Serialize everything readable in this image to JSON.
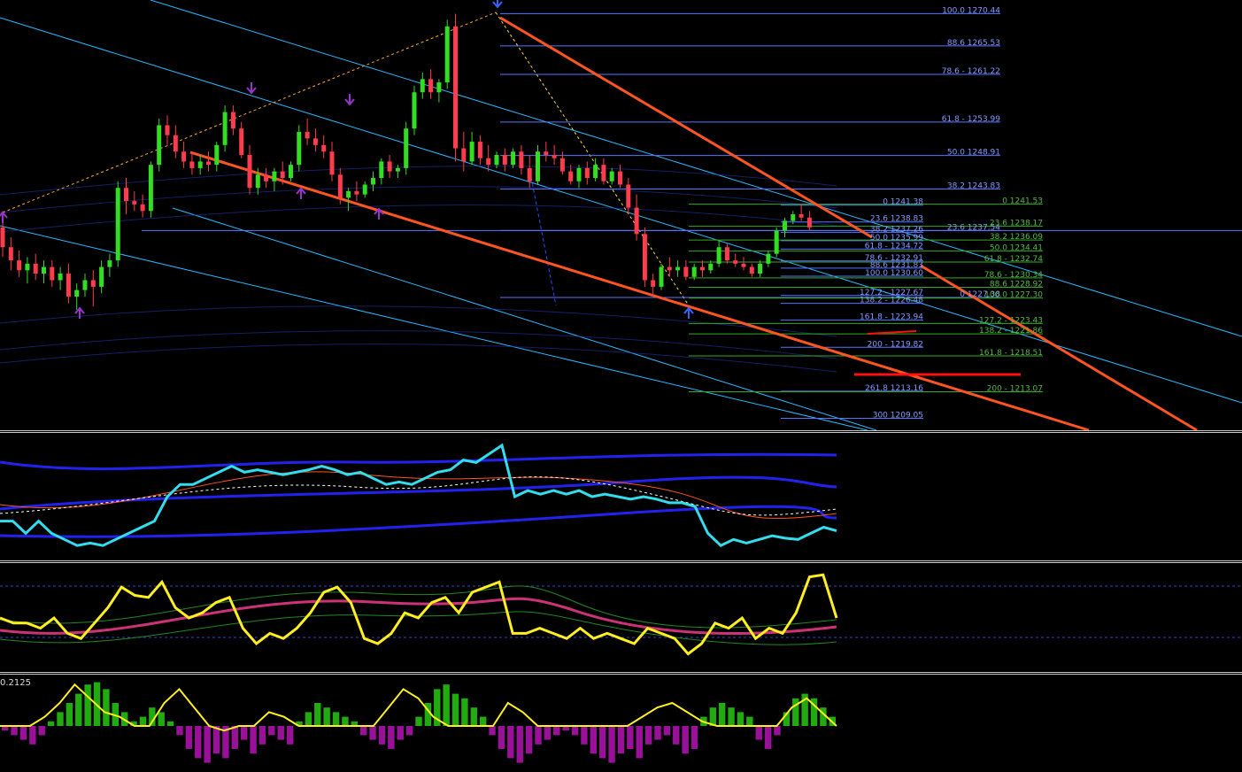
{
  "chart_data": [
    {
      "type": "candlestick",
      "panel": "price",
      "colors": {
        "up": "#33dd22",
        "down": "#ff3b4e",
        "fib_primary": "#5577ff",
        "fib_secondary": "#33aa22",
        "trendline": "#ff5522",
        "channel": "#2ab8ff",
        "arrow": "#9933cc",
        "arrow_blue": "#3366ff"
      },
      "ylim": [
        1207.5,
        1272.5
      ],
      "candles": [
        {
          "o": 1238.0,
          "h": 1240.5,
          "l": 1233.5,
          "c": 1235.0
        },
        {
          "o": 1235.0,
          "h": 1236.5,
          "l": 1231.5,
          "c": 1233.0
        },
        {
          "o": 1233.0,
          "h": 1234.5,
          "l": 1230.5,
          "c": 1231.5
        },
        {
          "o": 1231.5,
          "h": 1233.5,
          "l": 1229.5,
          "c": 1232.5
        },
        {
          "o": 1232.5,
          "h": 1234.0,
          "l": 1230.0,
          "c": 1231.0
        },
        {
          "o": 1231.0,
          "h": 1233.0,
          "l": 1229.5,
          "c": 1232.0
        },
        {
          "o": 1232.0,
          "h": 1233.0,
          "l": 1229.0,
          "c": 1230.0
        },
        {
          "o": 1230.0,
          "h": 1232.0,
          "l": 1228.5,
          "c": 1231.0
        },
        {
          "o": 1231.0,
          "h": 1232.5,
          "l": 1226.5,
          "c": 1227.5
        },
        {
          "o": 1227.5,
          "h": 1229.5,
          "l": 1225.5,
          "c": 1228.5
        },
        {
          "o": 1228.5,
          "h": 1231.0,
          "l": 1227.5,
          "c": 1230.0
        },
        {
          "o": 1230.0,
          "h": 1231.5,
          "l": 1226.0,
          "c": 1229.0
        },
        {
          "o": 1229.0,
          "h": 1233.0,
          "l": 1228.0,
          "c": 1232.0
        },
        {
          "o": 1232.0,
          "h": 1234.0,
          "l": 1230.5,
          "c": 1233.0
        },
        {
          "o": 1233.0,
          "h": 1245.0,
          "l": 1232.0,
          "c": 1244.0
        },
        {
          "o": 1244.0,
          "h": 1245.5,
          "l": 1240.0,
          "c": 1242.0
        },
        {
          "o": 1242.0,
          "h": 1243.5,
          "l": 1240.5,
          "c": 1241.5
        },
        {
          "o": 1241.5,
          "h": 1243.0,
          "l": 1239.5,
          "c": 1240.5
        },
        {
          "o": 1240.5,
          "h": 1248.0,
          "l": 1239.5,
          "c": 1247.5
        },
        {
          "o": 1247.5,
          "h": 1254.5,
          "l": 1246.5,
          "c": 1253.5
        },
        {
          "o": 1253.5,
          "h": 1255.0,
          "l": 1250.5,
          "c": 1252.0
        },
        {
          "o": 1252.0,
          "h": 1253.5,
          "l": 1248.5,
          "c": 1249.5
        },
        {
          "o": 1249.5,
          "h": 1251.0,
          "l": 1247.0,
          "c": 1248.0
        },
        {
          "o": 1248.0,
          "h": 1249.5,
          "l": 1246.0,
          "c": 1247.0
        },
        {
          "o": 1247.0,
          "h": 1249.0,
          "l": 1246.0,
          "c": 1248.0
        },
        {
          "o": 1248.0,
          "h": 1249.5,
          "l": 1246.5,
          "c": 1247.5
        },
        {
          "o": 1247.5,
          "h": 1251.0,
          "l": 1246.5,
          "c": 1250.5
        },
        {
          "o": 1250.5,
          "h": 1256.5,
          "l": 1249.5,
          "c": 1255.5
        },
        {
          "o": 1255.5,
          "h": 1256.5,
          "l": 1252.0,
          "c": 1253.0
        },
        {
          "o": 1253.0,
          "h": 1254.0,
          "l": 1248.5,
          "c": 1249.0
        },
        {
          "o": 1249.0,
          "h": 1250.5,
          "l": 1243.0,
          "c": 1244.0
        },
        {
          "o": 1244.0,
          "h": 1247.0,
          "l": 1243.0,
          "c": 1246.0
        },
        {
          "o": 1246.0,
          "h": 1247.0,
          "l": 1244.0,
          "c": 1245.0
        },
        {
          "o": 1245.0,
          "h": 1247.0,
          "l": 1243.5,
          "c": 1246.5
        },
        {
          "o": 1246.5,
          "h": 1248.0,
          "l": 1244.5,
          "c": 1245.5
        },
        {
          "o": 1245.5,
          "h": 1248.0,
          "l": 1245.0,
          "c": 1247.5
        },
        {
          "o": 1247.5,
          "h": 1253.5,
          "l": 1246.5,
          "c": 1252.5
        },
        {
          "o": 1252.5,
          "h": 1254.5,
          "l": 1250.5,
          "c": 1251.5
        },
        {
          "o": 1251.5,
          "h": 1253.0,
          "l": 1249.5,
          "c": 1250.5
        },
        {
          "o": 1250.5,
          "h": 1252.0,
          "l": 1248.5,
          "c": 1249.5
        },
        {
          "o": 1249.5,
          "h": 1251.0,
          "l": 1245.0,
          "c": 1246.0
        },
        {
          "o": 1246.0,
          "h": 1247.0,
          "l": 1241.5,
          "c": 1242.5
        },
        {
          "o": 1242.5,
          "h": 1244.0,
          "l": 1240.5,
          "c": 1243.5
        },
        {
          "o": 1243.5,
          "h": 1245.0,
          "l": 1242.0,
          "c": 1243.0
        },
        {
          "o": 1243.0,
          "h": 1245.0,
          "l": 1242.5,
          "c": 1244.5
        },
        {
          "o": 1244.5,
          "h": 1246.5,
          "l": 1243.5,
          "c": 1245.5
        },
        {
          "o": 1245.5,
          "h": 1248.5,
          "l": 1244.5,
          "c": 1248.0
        },
        {
          "o": 1248.0,
          "h": 1249.0,
          "l": 1245.5,
          "c": 1246.5
        },
        {
          "o": 1246.5,
          "h": 1247.5,
          "l": 1245.5,
          "c": 1247.0
        },
        {
          "o": 1247.0,
          "h": 1254.0,
          "l": 1246.0,
          "c": 1253.0
        },
        {
          "o": 1253.0,
          "h": 1259.5,
          "l": 1252.0,
          "c": 1258.5
        },
        {
          "o": 1258.5,
          "h": 1261.5,
          "l": 1257.5,
          "c": 1260.5
        },
        {
          "o": 1260.5,
          "h": 1262.0,
          "l": 1257.5,
          "c": 1258.5
        },
        {
          "o": 1258.5,
          "h": 1260.5,
          "l": 1257.0,
          "c": 1260.0
        },
        {
          "o": 1260.0,
          "h": 1269.5,
          "l": 1259.0,
          "c": 1268.5
        },
        {
          "o": 1268.5,
          "h": 1270.4,
          "l": 1248.0,
          "c": 1250.0
        },
        {
          "o": 1250.0,
          "h": 1252.5,
          "l": 1246.5,
          "c": 1248.0
        },
        {
          "o": 1248.0,
          "h": 1252.5,
          "l": 1247.5,
          "c": 1251.0
        },
        {
          "o": 1251.0,
          "h": 1252.0,
          "l": 1247.5,
          "c": 1248.5
        },
        {
          "o": 1248.5,
          "h": 1250.5,
          "l": 1246.5,
          "c": 1247.5
        },
        {
          "o": 1247.5,
          "h": 1249.5,
          "l": 1247.0,
          "c": 1249.0
        },
        {
          "o": 1249.0,
          "h": 1250.0,
          "l": 1246.5,
          "c": 1247.5
        },
        {
          "o": 1247.5,
          "h": 1250.0,
          "l": 1247.0,
          "c": 1249.5
        },
        {
          "o": 1249.5,
          "h": 1250.5,
          "l": 1246.0,
          "c": 1247.0
        },
        {
          "o": 1247.0,
          "h": 1249.0,
          "l": 1244.0,
          "c": 1245.0
        },
        {
          "o": 1245.0,
          "h": 1250.5,
          "l": 1244.5,
          "c": 1249.5
        },
        {
          "o": 1249.5,
          "h": 1251.0,
          "l": 1248.0,
          "c": 1249.0
        },
        {
          "o": 1249.0,
          "h": 1250.5,
          "l": 1247.5,
          "c": 1248.5
        },
        {
          "o": 1248.5,
          "h": 1249.5,
          "l": 1246.0,
          "c": 1246.5
        },
        {
          "o": 1246.5,
          "h": 1247.5,
          "l": 1244.5,
          "c": 1245.0
        },
        {
          "o": 1245.0,
          "h": 1247.5,
          "l": 1244.0,
          "c": 1247.0
        },
        {
          "o": 1247.0,
          "h": 1248.0,
          "l": 1244.5,
          "c": 1245.5
        },
        {
          "o": 1245.5,
          "h": 1248.5,
          "l": 1245.0,
          "c": 1247.5
        },
        {
          "o": 1247.5,
          "h": 1248.5,
          "l": 1244.5,
          "c": 1245.0
        },
        {
          "o": 1245.0,
          "h": 1247.0,
          "l": 1244.5,
          "c": 1246.5
        },
        {
          "o": 1246.5,
          "h": 1247.5,
          "l": 1244.0,
          "c": 1244.5
        },
        {
          "o": 1244.5,
          "h": 1245.5,
          "l": 1240.0,
          "c": 1241.0
        },
        {
          "o": 1241.0,
          "h": 1243.0,
          "l": 1236.0,
          "c": 1237.0
        },
        {
          "o": 1237.0,
          "h": 1238.0,
          "l": 1229.0,
          "c": 1230.0
        },
        {
          "o": 1230.0,
          "h": 1231.0,
          "l": 1227.5,
          "c": 1229.0
        },
        {
          "o": 1229.0,
          "h": 1232.5,
          "l": 1228.5,
          "c": 1232.0
        },
        {
          "o": 1232.0,
          "h": 1233.5,
          "l": 1230.5,
          "c": 1231.5
        },
        {
          "o": 1231.5,
          "h": 1233.0,
          "l": 1230.5,
          "c": 1232.0
        },
        {
          "o": 1232.0,
          "h": 1233.0,
          "l": 1230.0,
          "c": 1230.5
        },
        {
          "o": 1230.5,
          "h": 1232.5,
          "l": 1230.0,
          "c": 1232.0
        },
        {
          "o": 1232.0,
          "h": 1233.0,
          "l": 1230.5,
          "c": 1231.5
        },
        {
          "o": 1231.5,
          "h": 1233.0,
          "l": 1231.0,
          "c": 1232.5
        },
        {
          "o": 1232.5,
          "h": 1236.0,
          "l": 1232.0,
          "c": 1235.0
        },
        {
          "o": 1235.0,
          "h": 1235.5,
          "l": 1232.5,
          "c": 1233.0
        },
        {
          "o": 1233.0,
          "h": 1234.0,
          "l": 1232.0,
          "c": 1232.5
        },
        {
          "o": 1232.5,
          "h": 1233.5,
          "l": 1231.5,
          "c": 1232.0
        },
        {
          "o": 1232.0,
          "h": 1232.5,
          "l": 1230.5,
          "c": 1231.0
        },
        {
          "o": 1231.0,
          "h": 1233.0,
          "l": 1230.5,
          "c": 1232.5
        },
        {
          "o": 1232.5,
          "h": 1234.5,
          "l": 1232.0,
          "c": 1234.0
        },
        {
          "o": 1234.0,
          "h": 1238.0,
          "l": 1233.5,
          "c": 1237.5
        },
        {
          "o": 1237.5,
          "h": 1239.5,
          "l": 1236.5,
          "c": 1239.0
        },
        {
          "o": 1239.0,
          "h": 1240.5,
          "l": 1238.5,
          "c": 1240.0
        },
        {
          "o": 1240.0,
          "h": 1241.5,
          "l": 1239.0,
          "c": 1239.5
        },
        {
          "o": 1239.5,
          "h": 1240.5,
          "l": 1237.5,
          "c": 1238.0
        }
      ],
      "fib_levels_primary": [
        {
          "label": "100.0 1270.44",
          "value": 1270.44
        },
        {
          "label": "88.6 1265.53",
          "value": 1265.53
        },
        {
          "label": "78.6 - 1261.22",
          "value": 1261.22
        },
        {
          "label": "61.8 - 1253.99",
          "value": 1253.99
        },
        {
          "label": "50.0 1248.91",
          "value": 1248.91
        },
        {
          "label": "38.2 1243.83",
          "value": 1243.83
        },
        {
          "label": "23.6 1237.54",
          "value": 1237.54
        },
        {
          "label": "0 1227.38",
          "value": 1227.38
        }
      ],
      "fib_levels_mid": [
        {
          "label": "0 1241.38",
          "value": 1241.38
        },
        {
          "label": "23.6 1238.83",
          "value": 1238.83
        },
        {
          "label": "38.2 1237.26",
          "value": 1237.26
        },
        {
          "label": "50.0 1235.99",
          "value": 1235.99
        },
        {
          "label": "61.8 - 1234.72",
          "value": 1234.72
        },
        {
          "label": "78.6 - 1232.91",
          "value": 1232.91
        },
        {
          "label": "88.6 1231.83",
          "value": 1231.83
        },
        {
          "label": "100.0 1230.60",
          "value": 1230.6
        },
        {
          "label": "127.2 - 1227.67",
          "value": 1227.67
        },
        {
          "label": "138.2 - 1226.48",
          "value": 1226.48
        },
        {
          "label": "161.8 - 1223.94",
          "value": 1223.94
        },
        {
          "label": "200 - 1219.82",
          "value": 1219.82
        },
        {
          "label": "261.8 1213.16",
          "value": 1213.16
        },
        {
          "label": "300 1209.05",
          "value": 1209.05
        }
      ],
      "fib_levels_secondary": [
        {
          "label": "0 1241.53",
          "value": 1241.53
        },
        {
          "label": "23.6 1238.17",
          "value": 1238.17
        },
        {
          "label": "38.2 1236.09",
          "value": 1236.09
        },
        {
          "label": "50.0 1234.41",
          "value": 1234.41
        },
        {
          "label": "61.8 - 1232.74",
          "value": 1232.74
        },
        {
          "label": "78.6 - 1230.34",
          "value": 1230.34
        },
        {
          "label": "88.6 1228.92",
          "value": 1228.92
        },
        {
          "label": "100.0 1227.30",
          "value": 1227.3
        },
        {
          "label": "127.2 - 1223.43",
          "value": 1223.43
        },
        {
          "label": "138.2 - 1221.86",
          "value": 1221.86
        },
        {
          "label": "161.8 - 1218.51",
          "value": 1218.51
        },
        {
          "label": "200 - 1213.07",
          "value": 1213.07
        }
      ]
    },
    {
      "type": "line",
      "panel": "indicator-1",
      "series": [
        {
          "values": [
            0.3,
            0.3,
            0.2,
            0.3,
            0.2,
            0.15,
            0.1,
            0.12,
            0.1,
            0.15,
            0.2,
            0.25,
            0.3,
            0.5,
            0.6,
            0.6,
            0.65,
            0.7,
            0.75,
            0.7,
            0.72,
            0.7,
            0.68,
            0.7,
            0.72,
            0.75,
            0.72,
            0.68,
            0.7,
            0.65,
            0.6,
            0.62,
            0.6,
            0.65,
            0.7,
            0.72,
            0.8,
            0.78,
            0.85,
            0.92,
            0.5,
            0.55,
            0.52,
            0.55,
            0.52,
            0.55,
            0.5,
            0.52,
            0.5,
            0.48,
            0.5,
            0.48,
            0.45,
            0.45,
            0.42,
            0.2,
            0.1,
            0.15,
            0.12,
            0.15,
            0.18,
            0.16,
            0.15,
            0.2,
            0.25,
            0.22
          ]
        }
      ]
    },
    {
      "type": "line",
      "panel": "indicator-2",
      "series": [
        {
          "values": [
            0.5,
            0.45,
            0.45,
            0.4,
            0.5,
            0.35,
            0.3,
            0.45,
            0.6,
            0.8,
            0.72,
            0.7,
            0.85,
            0.6,
            0.5,
            0.55,
            0.65,
            0.7,
            0.4,
            0.25,
            0.35,
            0.3,
            0.4,
            0.55,
            0.75,
            0.8,
            0.65,
            0.3,
            0.25,
            0.35,
            0.55,
            0.5,
            0.65,
            0.7,
            0.55,
            0.75,
            0.8,
            0.85,
            0.35,
            0.35,
            0.4,
            0.35,
            0.3,
            0.4,
            0.3,
            0.35,
            0.3,
            0.25,
            0.4,
            0.35,
            0.3,
            0.15,
            0.25,
            0.45,
            0.4,
            0.5,
            0.3,
            0.4,
            0.35,
            0.55,
            0.9,
            0.92,
            0.5
          ]
        }
      ]
    },
    {
      "type": "bar",
      "panel": "indicator-3",
      "title": "0.2125",
      "values": [
        -0.1,
        -0.2,
        -0.3,
        -0.4,
        -0.2,
        0.1,
        0.3,
        0.5,
        0.7,
        0.9,
        0.95,
        0.8,
        0.5,
        0.3,
        0.1,
        0.2,
        0.4,
        0.3,
        0.1,
        -0.2,
        -0.5,
        -0.7,
        -0.8,
        -0.6,
        -0.7,
        -0.5,
        -0.3,
        -0.6,
        -0.4,
        -0.2,
        -0.3,
        -0.4,
        0.1,
        0.3,
        0.5,
        0.4,
        0.3,
        0.2,
        0.1,
        -0.2,
        -0.3,
        -0.4,
        -0.5,
        -0.3,
        -0.2,
        0.2,
        0.5,
        0.8,
        0.9,
        0.7,
        0.6,
        0.4,
        0.2,
        -0.2,
        -0.5,
        -0.7,
        -0.8,
        -0.6,
        -0.4,
        -0.3,
        -0.2,
        -0.1,
        -0.2,
        -0.4,
        -0.6,
        -0.7,
        -0.8,
        -0.6,
        -0.5,
        -0.7,
        -0.4,
        -0.3,
        -0.2,
        -0.4,
        -0.6,
        -0.5,
        0.2,
        0.4,
        0.5,
        0.4,
        0.3,
        0.2,
        -0.3,
        -0.5,
        -0.2,
        0.3,
        0.6,
        0.7,
        0.6,
        0.4,
        0.2
      ],
      "signal": [
        0.0,
        0.0,
        0.0,
        0.2,
        0.5,
        0.9,
        0.6,
        0.3,
        0.2,
        0.0,
        0.0,
        0.5,
        0.8,
        0.4,
        0.0,
        -0.1,
        0.0,
        0.0,
        0.3,
        0.2,
        0.0,
        0.0,
        0.0,
        0.0,
        0.0,
        0.0,
        0.4,
        0.8,
        0.6,
        0.2,
        0.0,
        0.0,
        0.0,
        0.0,
        0.5,
        0.3,
        0.0,
        0.0,
        0.0,
        0.0,
        0.0,
        0.0,
        0.0,
        0.2,
        0.4,
        0.5,
        0.3,
        0.1,
        0.0,
        0.0,
        0.0,
        0.0,
        0.0,
        0.4,
        0.6,
        0.3,
        0.0
      ]
    }
  ]
}
